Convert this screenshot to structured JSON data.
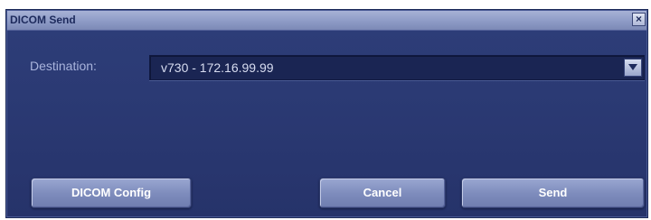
{
  "dialog": {
    "title": "DICOM Send",
    "close_glyph": "×",
    "destination_label": "Destination:",
    "destination_value": "v730 - 172.16.99.99",
    "buttons": {
      "dicom_config": "DICOM Config",
      "cancel": "Cancel",
      "send": "Send"
    }
  },
  "icons": {
    "close": "close-icon",
    "dropdown": "chevron-down-icon"
  }
}
